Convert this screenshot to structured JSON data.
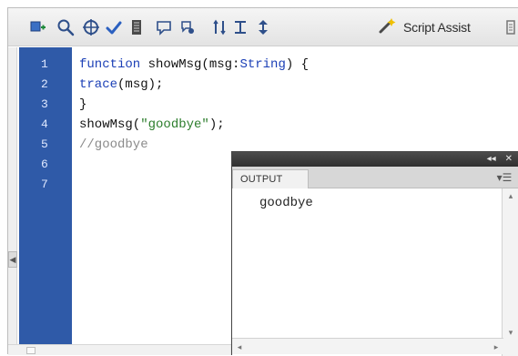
{
  "toolbar": {
    "icons": [
      "add-statement-icon",
      "find-icon",
      "target-icon",
      "check-syntax-icon",
      "auto-format-icon",
      "code-hint-icon",
      "debug-options-icon",
      "collapse-between-braces-icon",
      "collapse-selection-icon",
      "expand-all-icon"
    ],
    "script_assist_label": "Script Assist"
  },
  "editor": {
    "line_numbers": [
      "1",
      "2",
      "3",
      "4",
      "5",
      "6",
      "7"
    ],
    "lines": [
      [
        {
          "text": "function",
          "kind": "kw"
        },
        {
          "text": " showMsg(msg:",
          "kind": "plain"
        },
        {
          "text": "String",
          "kind": "kw"
        },
        {
          "text": ") {",
          "kind": "plain"
        }
      ],
      [
        {
          "text": "trace",
          "kind": "kw"
        },
        {
          "text": "(msg);",
          "kind": "plain"
        }
      ],
      [
        {
          "text": "}",
          "kind": "plain"
        }
      ],
      [
        {
          "text": "showMsg(",
          "kind": "plain"
        },
        {
          "text": "\"goodbye\"",
          "kind": "str"
        },
        {
          "text": ");",
          "kind": "plain"
        }
      ],
      [
        {
          "text": "//goodbye",
          "kind": "cmt"
        }
      ]
    ]
  },
  "output_panel": {
    "tab_label": "OUTPUT",
    "content": "goodbye"
  },
  "colors": {
    "gutter": "#2f5aa8",
    "keyword": "#1b3fb6",
    "string": "#2c7d2c",
    "comment": "#8a8a8a",
    "panel_title": "#3a3a3a"
  }
}
